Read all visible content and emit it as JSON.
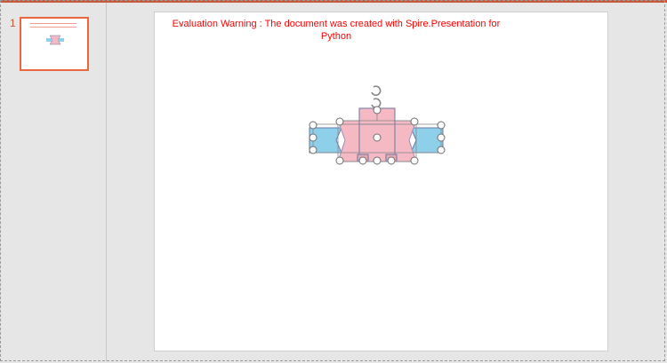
{
  "thumbnail_pane": {
    "slide_number": "1"
  },
  "slide": {
    "warning_text": "Evaluation Warning : The document was created with Spire.Presentation for Python"
  },
  "colors": {
    "accent": "#c55a3d",
    "thumbnail_border": "#e9663f",
    "warning": "#ff0000",
    "ribbon_blue": "#8ecfe9",
    "ribbon_pink": "#f4b9c2",
    "outline": "#6b78a8"
  },
  "icons": [
    "rotate-handle-icon"
  ]
}
